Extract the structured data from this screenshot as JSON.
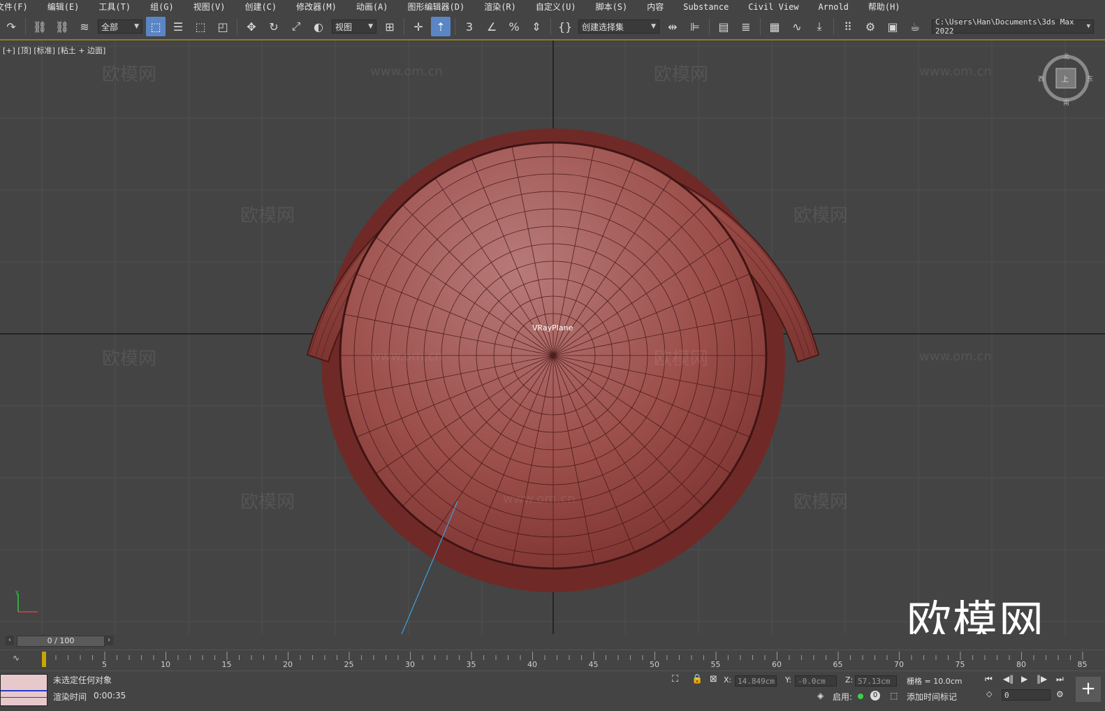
{
  "menu": [
    "文件(F)",
    "编辑(E)",
    "工具(T)",
    "组(G)",
    "视图(V)",
    "创建(C)",
    "修改器(M)",
    "动画(A)",
    "图形编辑器(D)",
    "渲染(R)",
    "自定义(U)",
    "脚本(S)",
    "内容",
    "Substance",
    "Civil View",
    "Arnold",
    "帮助(H)"
  ],
  "toolbar": {
    "filter_value": "全部",
    "ref_coord_value": "视图",
    "selection_set_placeholder": "创建选择集",
    "project_path": "C:\\Users\\Han\\Documents\\3ds Max 2022"
  },
  "viewport": {
    "label": "[+] [顶] [标准] [粘土 + 边面]",
    "object_name": "VRayPlane",
    "watermark_cn": "欧模网",
    "watermark_url": "www.om.cn",
    "brand": "欧模网",
    "viewcube_faces": {
      "top": "上",
      "north": "北",
      "south": "南",
      "east": "东",
      "west": "西"
    }
  },
  "timeline": {
    "frame_display": "0 / 100",
    "ticks": [
      5,
      10,
      15,
      20,
      25,
      30,
      35,
      40,
      45,
      50,
      55,
      60,
      65,
      70,
      75,
      80,
      85
    ]
  },
  "status": {
    "selection": "未选定任何对象",
    "render_time_label": "渲染时间",
    "render_time_value": "0:00:35",
    "x_label": "X:",
    "x_value": "14.849cm",
    "y_label": "Y:",
    "y_value": "-0.0cm",
    "z_label": "Z:",
    "z_value": "57.13cm",
    "grid": "栅格 = 10.0cm",
    "enable_label": "启用:",
    "enable_count": "0",
    "add_time_tag": "添加时间标记",
    "current_frame": "0"
  },
  "icons": [
    "undo-icon",
    "redo-icon",
    "link-icon",
    "unlink-icon",
    "bind-space-warp-icon",
    "select-icon",
    "select-by-name-icon",
    "rect-region-icon",
    "window-crossing-icon",
    "move-icon",
    "rotate-icon",
    "scale-icon",
    "place-icon",
    "snap-3-icon",
    "angle-snap-icon",
    "percent-snap-icon",
    "spinner-snap-icon",
    "mirror-icon",
    "align-icon",
    "layer-icon",
    "ribbon-icon",
    "curve-editor-icon",
    "schematic-icon",
    "material-editor-icon",
    "render-setup-icon",
    "render-frame-icon",
    "render-icon"
  ],
  "colors": {
    "accent": "#5b86c5",
    "model": "#9c4a46",
    "viewport_bg": "#444444"
  }
}
